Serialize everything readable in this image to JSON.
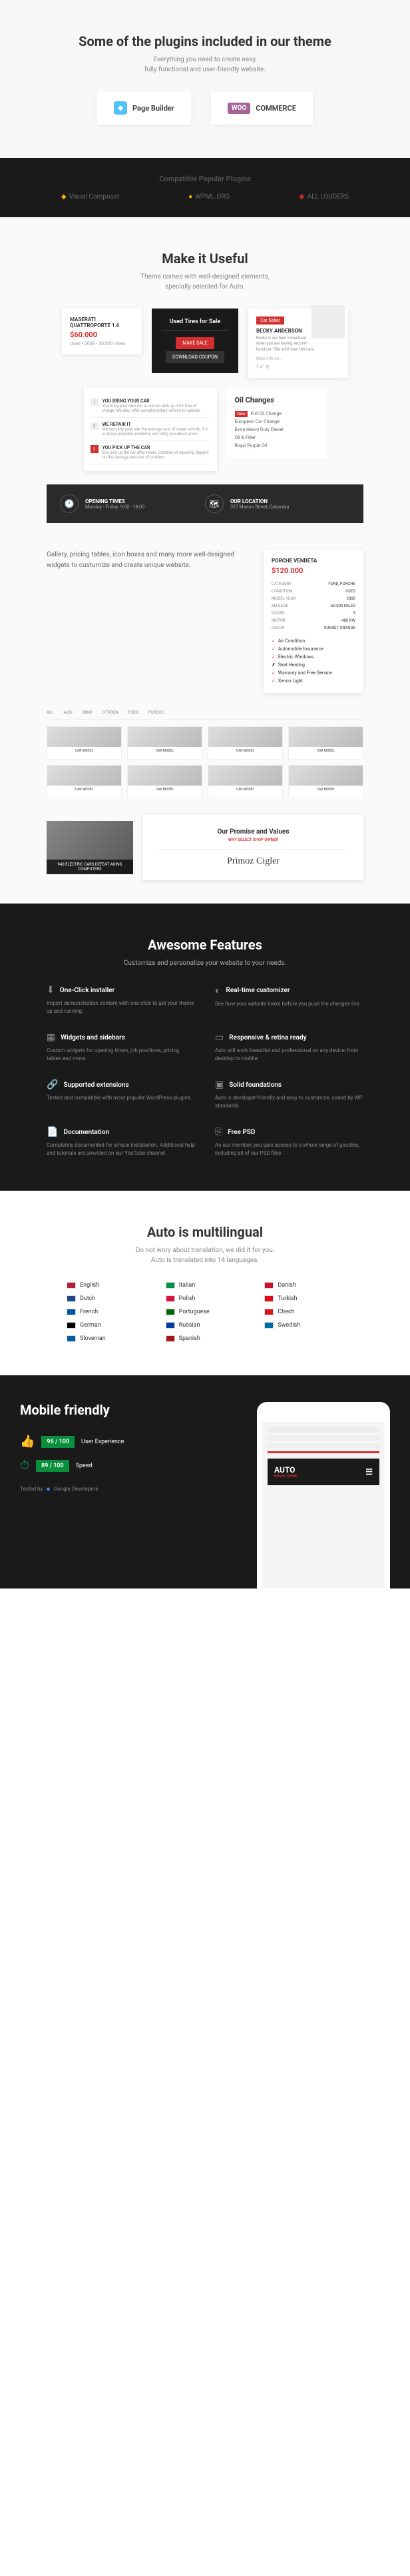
{
  "plugins": {
    "title": "Some of the plugins included in our theme",
    "sub": "Everything you need to create easy,\nfully functional and user-friendly website.",
    "card1": "Page Builder",
    "card2": "COMMERCE",
    "woo": "WOO"
  },
  "compat": {
    "title": "Compatible Popular Plugins",
    "items": [
      "Visual Composer",
      "WPML.ORG",
      "ALL LOUDERS"
    ]
  },
  "useful": {
    "title": "Make it Useful",
    "sub": "Theme comes with well-designed elements,\nspecially selected for Auto."
  },
  "priceCard": {
    "title": "MASERATI QUATTROPORTE 1.6",
    "price": "$60.000",
    "meta": "Used • 2008 • 30.000 miles"
  },
  "tires": {
    "title": "Used Tires for Sale",
    "btn1": "MAKE SALE",
    "btn2": "DOWNLOAD COUPON"
  },
  "seller": {
    "badge": "Car Seller",
    "name": "BECKY ANDERSON",
    "desc": "Becky is our best consultant when you are buying second-hand car. She sold over 140 cars.",
    "contact": "More info on..."
  },
  "steps": [
    {
      "n": "1",
      "title": "YOU BRING YOUR CAR",
      "desc": "You bring your own car or we can pick up it for free of charge. We also offer complimentary vehicle to operate."
    },
    {
      "n": "2",
      "title": "WE REPAIR IT",
      "desc": "We honestly estimate the average cost of repair vehicle. If it is above possible problems, we notify you about price."
    },
    {
      "n": "3",
      "title": "YOU PICK UP THE CAR",
      "desc": "You pick up the car after repair. Duration of repairing depend on the damage and size of problem."
    }
  ],
  "oil": {
    "title": "Oil Changes",
    "items": [
      "Full Oil Change",
      "European Car Change",
      "Extra Heavy Duty Diesel",
      "Oil & Filter",
      "Royal Purple Oil"
    ]
  },
  "infoBar": {
    "times": {
      "label": "OPENING TIMES",
      "val": "Monday - Friday: 9:00 - 18:00"
    },
    "location": {
      "label": "OUR LOCATION",
      "val": "327 Marion Street, Columbia"
    }
  },
  "gallery": {
    "text": "Gallery, pricing tables, icon boxes and many more well-designed widgets to custumize and create unique website."
  },
  "vendeta": {
    "title": "PORCHE VENDETA",
    "price": "$120.000",
    "specs": [
      [
        "CATEGORY",
        "FORD, PORCHE"
      ],
      [
        "CONDITION",
        "USED"
      ],
      [
        "MODEL YEAR",
        "2006"
      ],
      [
        "MILEAGE",
        "60.000 MILES"
      ],
      [
        "DOORS",
        "5"
      ],
      [
        "MOTOR",
        "400 KW"
      ],
      [
        "COLOR",
        "SUNSET ORANGE"
      ]
    ],
    "checks": [
      {
        "on": true,
        "label": "Air Condition"
      },
      {
        "on": true,
        "label": "Automobile Insurance"
      },
      {
        "on": true,
        "label": "Electric Windows"
      },
      {
        "on": false,
        "label": "Seat Heating"
      },
      {
        "on": true,
        "label": "Warranty and Free Service"
      },
      {
        "on": true,
        "label": "Xenon Light"
      }
    ]
  },
  "promise": {
    "title": "Our Promise and Values",
    "sub": "WHY SELECT SHOP OWNER",
    "signature": "Primoz Cigler"
  },
  "mechCaption": "940 ELECTRIC CARS DEFEAT AGING COMPUTERS",
  "features": {
    "title": "Awesome Features",
    "sub": "Customize and personalize your website to your needs.",
    "items": [
      {
        "icon": "⬇",
        "title": "One-Click installer",
        "desc": "Import demonstration content with one click to get your theme up and running."
      },
      {
        "icon": "◐",
        "title": "Real-time customizer",
        "desc": "See how your website looks before you push the changes live."
      },
      {
        "icon": "▦",
        "title": "Widgets and sidebars",
        "desc": "Custom widgets for opening times, job positions, pricing tables and more."
      },
      {
        "icon": "▭",
        "title": "Responsive & retina ready",
        "desc": "Auto will work beautiful and professional on any device, from desktop to mobile."
      },
      {
        "icon": "🔗",
        "title": "Supported extensions",
        "desc": "Tested and compatible with most popular WordPress plugins."
      },
      {
        "icon": "▣",
        "title": "Solid foundations",
        "desc": "Auto is developer-friendly and easy to customize, coded by WP standards."
      },
      {
        "icon": "📄",
        "title": "Documentation",
        "desc": "Completely documented for simple installation. Additional help and tutorials are provided on our YouTube channel."
      },
      {
        "icon": "⎘",
        "title": "Free PSD",
        "desc": "As our member, you gain access to a whole range of goodies, including all of our PSD files."
      }
    ]
  },
  "multilingual": {
    "title": "Auto is multilingual",
    "sub": "Do not wory about translation, we did it for you.\nAuto is translated into 14 languages.",
    "langs": [
      {
        "flag": "#b22234",
        "name": "English"
      },
      {
        "flag": "#009246",
        "name": "Italian"
      },
      {
        "flag": "#c8102e",
        "name": "Danish"
      },
      {
        "flag": "#21468b",
        "name": "Dutch"
      },
      {
        "flag": "#dc143c",
        "name": "Polish"
      },
      {
        "flag": "#e30a17",
        "name": "Turkish"
      },
      {
        "flag": "#0055a4",
        "name": "French"
      },
      {
        "flag": "#006600",
        "name": "Portuguese"
      },
      {
        "flag": "#d7141a",
        "name": "Chech"
      },
      {
        "flag": "#000",
        "name": "German"
      },
      {
        "flag": "#0039a6",
        "name": "Russian"
      },
      {
        "flag": "#006aa7",
        "name": "Swedish"
      },
      {
        "flag": "#005da4",
        "name": "Slovenian"
      },
      {
        "flag": "#aa151b",
        "name": "Spanish"
      }
    ]
  },
  "mobile": {
    "title": "Mobile friendly",
    "ux": {
      "score": "96 / 100",
      "label": "User Experience"
    },
    "speed": {
      "score": "89 / 100",
      "label": "Speed"
    },
    "tested": "Tested by",
    "google": "Google Developers",
    "phoneLogo": "AUTO",
    "phoneSub": "REPAIR THEME"
  }
}
